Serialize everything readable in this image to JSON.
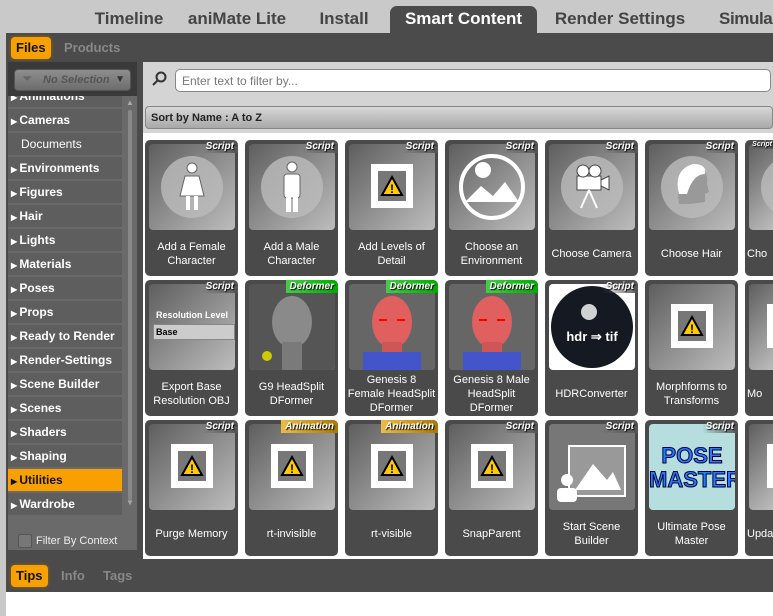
{
  "top_tabs": [
    {
      "label": "Timeline"
    },
    {
      "label": "aniMate Lite"
    },
    {
      "label": "Install"
    },
    {
      "label": "Smart Content",
      "active": true
    },
    {
      "label": "Render Settings"
    },
    {
      "label": "Simula"
    }
  ],
  "sub_tabs": [
    {
      "label": "Files",
      "active": true
    },
    {
      "label": "Products"
    }
  ],
  "filter_dropdown": "No Selection",
  "categories": [
    {
      "label": "Animations",
      "arrow": true
    },
    {
      "label": "Cameras",
      "arrow": true
    },
    {
      "label": "Documents",
      "arrow": false
    },
    {
      "label": "Environments",
      "arrow": true
    },
    {
      "label": "Figures",
      "arrow": true
    },
    {
      "label": "Hair",
      "arrow": true
    },
    {
      "label": "Lights",
      "arrow": true
    },
    {
      "label": "Materials",
      "arrow": true
    },
    {
      "label": "Poses",
      "arrow": true
    },
    {
      "label": "Props",
      "arrow": true
    },
    {
      "label": "Ready to Render",
      "arrow": true
    },
    {
      "label": "Render-Settings",
      "arrow": true
    },
    {
      "label": "Scene Builder",
      "arrow": true
    },
    {
      "label": "Scenes",
      "arrow": true
    },
    {
      "label": "Shaders",
      "arrow": true
    },
    {
      "label": "Shaping",
      "arrow": true
    },
    {
      "label": "Utilities",
      "arrow": true,
      "selected": true
    },
    {
      "label": "Wardrobe",
      "arrow": true
    }
  ],
  "filter_by_context": {
    "label": "Filter By Context",
    "checked": false
  },
  "search": {
    "placeholder": "Enter text to filter by...",
    "value": ""
  },
  "sort_label": "Sort by Name : A to Z",
  "tiles": [
    {
      "label": "Add a Female Character",
      "badge": "Script",
      "icon": "female-icon"
    },
    {
      "label": "Add a Male Character",
      "badge": "Script",
      "icon": "male-icon"
    },
    {
      "label": "Add Levels of Detail",
      "badge": "Script",
      "icon": "warning-icon"
    },
    {
      "label": "Choose an Environment",
      "badge": "Script",
      "icon": "environment-icon"
    },
    {
      "label": "Choose Camera",
      "badge": "Script",
      "icon": "camera-icon"
    },
    {
      "label": "Choose Hair",
      "badge": "Script",
      "icon": "hair-icon"
    },
    {
      "label": "Cho",
      "badge": "Script",
      "icon": "circle-icon"
    },
    {
      "label": "Export Base Resolution OBJ",
      "badge": "Script",
      "icon": "resolution-icon",
      "thumb_text": [
        "Resolution Level",
        "Base"
      ]
    },
    {
      "label": "G9 HeadSplit DFormer",
      "badge": "Deformer",
      "icon": "head-gray-icon"
    },
    {
      "label": "Genesis 8 Female HeadSplit DFormer",
      "badge": "Deformer",
      "icon": "head-red-icon"
    },
    {
      "label": "Genesis 8 Male HeadSplit DFormer",
      "badge": "Deformer",
      "icon": "head-red-icon"
    },
    {
      "label": "HDRConverter",
      "badge": "Script",
      "icon": "hdr-icon",
      "thumb_text": [
        "hdr ⇒ tif"
      ]
    },
    {
      "label": "Morphforms to Transforms",
      "badge": "",
      "icon": "warning-icon"
    },
    {
      "label": "Mo",
      "badge": "",
      "icon": "warning-icon"
    },
    {
      "label": "Purge Memory",
      "badge": "Script",
      "icon": "warning-icon"
    },
    {
      "label": "rt-invisible",
      "badge": "Animation",
      "icon": "warning-icon"
    },
    {
      "label": "rt-visible",
      "badge": "Animation",
      "icon": "warning-icon"
    },
    {
      "label": "SnapParent",
      "badge": "Script",
      "icon": "warning-icon"
    },
    {
      "label": "Start Scene Builder",
      "badge": "Script",
      "icon": "scene-builder-icon"
    },
    {
      "label": "Ultimate Pose Master",
      "badge": "Script",
      "icon": "pose-master-icon",
      "thumb_text": [
        "POSE",
        "MASTER"
      ]
    },
    {
      "label": "Upda",
      "badge": "",
      "icon": "warning-icon"
    }
  ],
  "bottom_tabs": [
    {
      "label": "Tips",
      "active": true
    },
    {
      "label": "Info"
    },
    {
      "label": "Tags"
    }
  ],
  "colors": {
    "accent": "#f7a000",
    "panel": "#4b4b4b"
  }
}
